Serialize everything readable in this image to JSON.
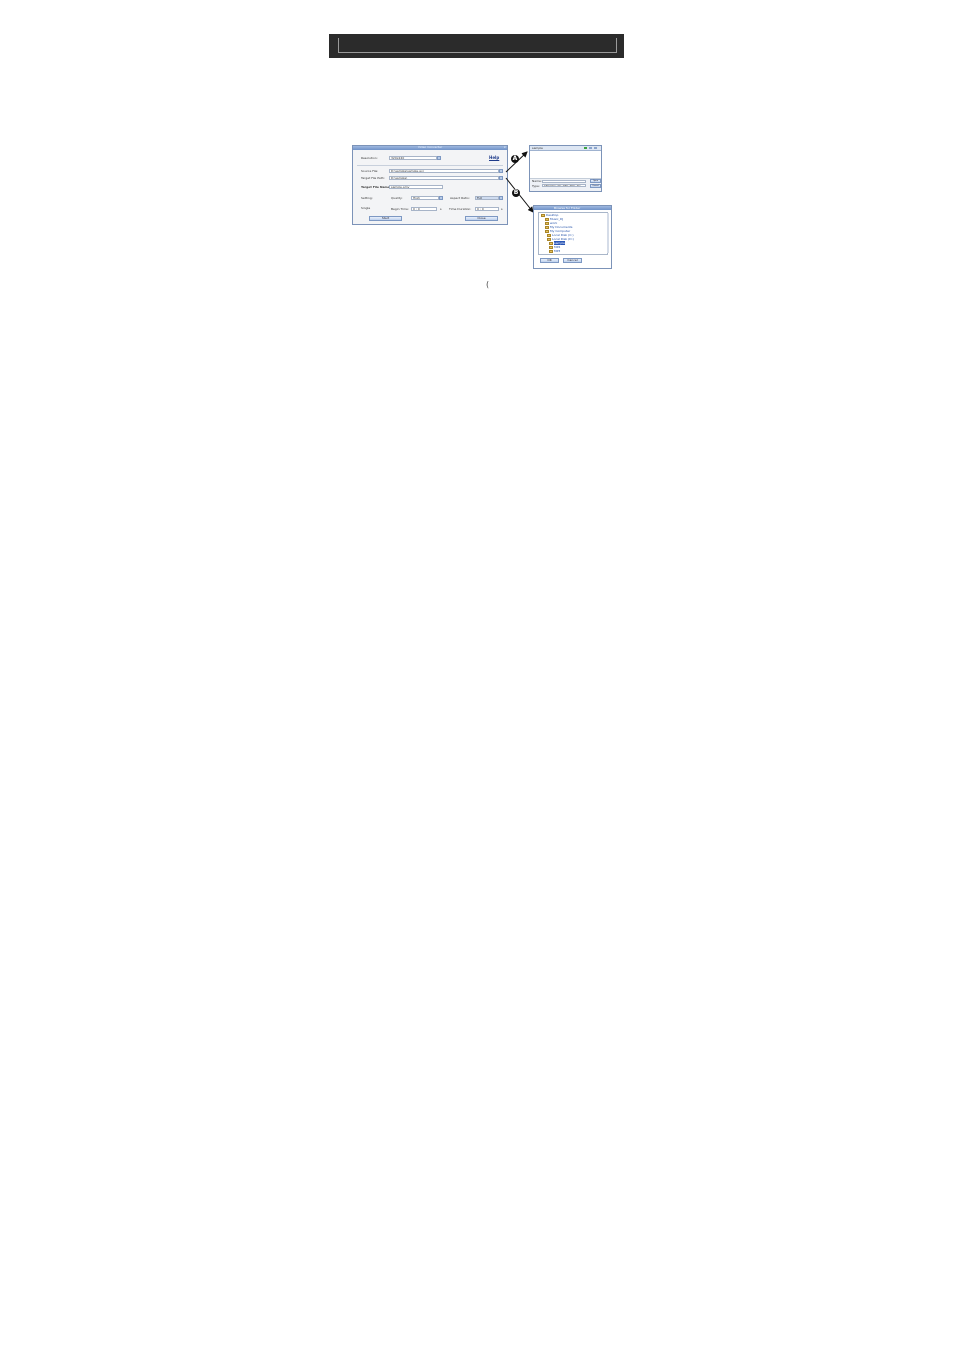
{
  "main_window": {
    "title": "Video Converter",
    "resolution_label": "Resolution:",
    "resolution_value": "320x240",
    "help_label": "Help",
    "source_file_label": "Source File:",
    "source_file_value": "D:\\sample\\sample.avi",
    "target_path_label": "Target File Path:",
    "target_path_value": "D:\\sample\\",
    "target_name_label": "Target File Name:",
    "target_name_value": "sample.amv",
    "setting_label": "Setting:",
    "quality_label": "Quality:",
    "quality_value": "High",
    "aspect_label": "Aspect Ratio:",
    "aspect_value": "Full",
    "single_label": "Single",
    "begin_label": "Begin Time:",
    "begin_value": "0 : 0",
    "time_duration_label": "Time Duration:",
    "time_duration_value": "0 : 0",
    "unit_s": "s",
    "start_button": "Start",
    "close_button": "Close"
  },
  "dialog_a": {
    "location": "sample",
    "file_name_label": "Name:",
    "file_type_label": "Type:",
    "file_type_value": "Video Files (*.avi;*.mpg;*.wmv;*.rm)",
    "open_button": "Open",
    "cancel_button": "Cancel"
  },
  "dialog_b": {
    "title": "Browse for Folder",
    "tree": [
      "Desktop",
      "Music_DJ",
      "work",
      "My Documents",
      "My Computer",
      "Local Disk (C:)",
      "Local Disk (D:)",
      "sample",
      "MP4",
      "MP3"
    ],
    "selected_index": 7,
    "ok_button": "OK",
    "cancel_button": "Cancel"
  },
  "callouts": {
    "a": "A",
    "b": "B"
  },
  "footnote": "("
}
